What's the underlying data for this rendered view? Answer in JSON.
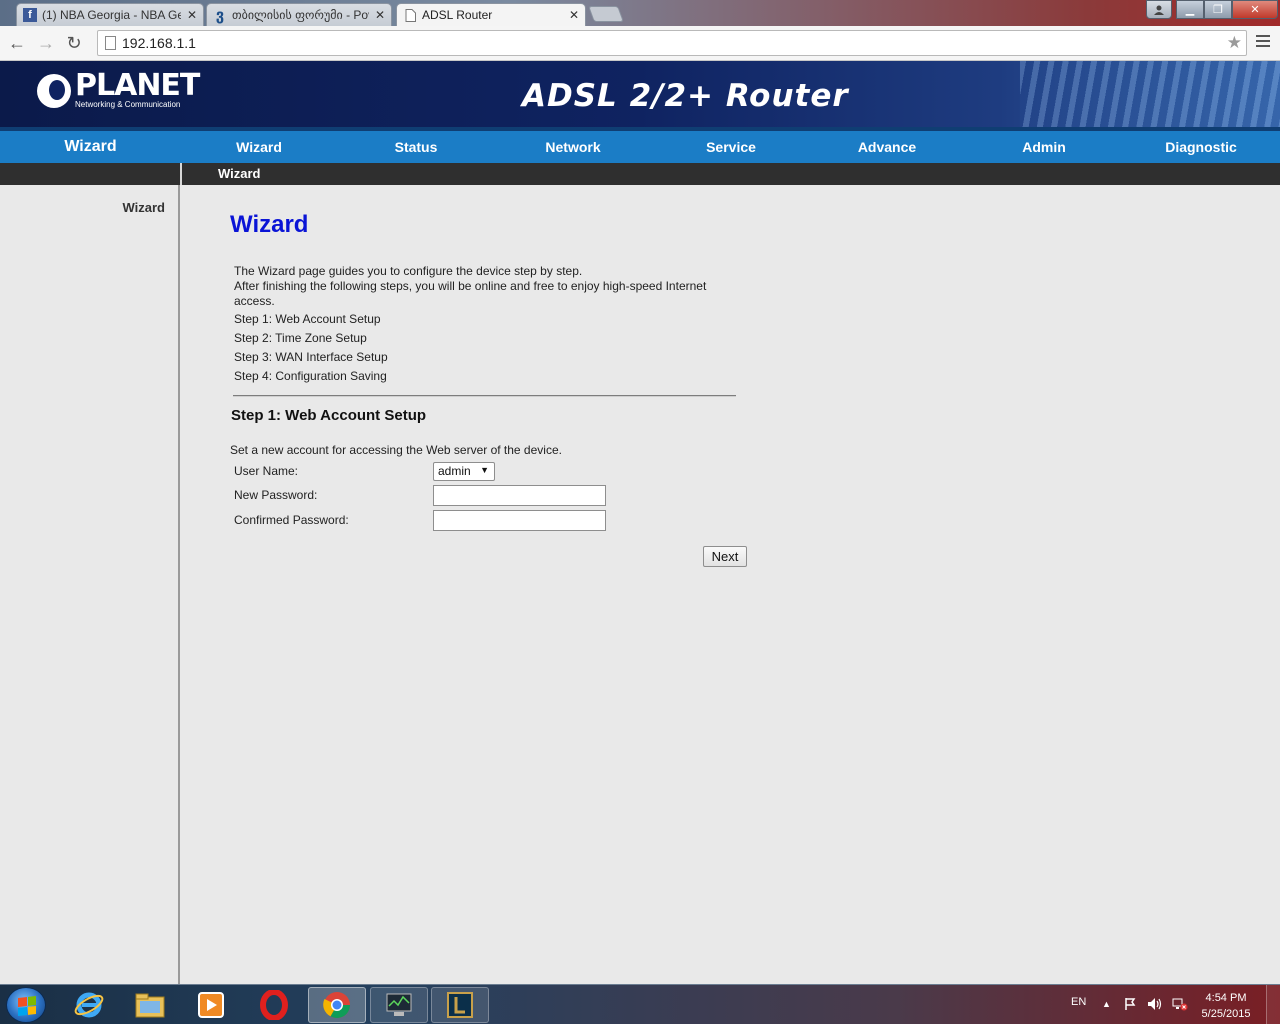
{
  "browser": {
    "tabs": [
      {
        "title": "(1) NBA Georgia - NBA Ge",
        "icon": "facebook-icon",
        "active": false
      },
      {
        "title": "თბილისის ფორუმი - Pov",
        "icon": "forum-icon",
        "active": false
      },
      {
        "title": "ADSL Router",
        "icon": "page-icon",
        "active": true
      }
    ],
    "url": "192.168.1.1"
  },
  "header": {
    "brand": "PLANET",
    "tagline": "Networking & Communication",
    "product": "ADSL 2/2+ Router"
  },
  "nav": {
    "current": "Wizard",
    "items": [
      "Wizard",
      "Status",
      "Network",
      "Service",
      "Advance",
      "Admin",
      "Diagnostic"
    ]
  },
  "subnav": {
    "item": "Wizard"
  },
  "sidebar": {
    "item": "Wizard"
  },
  "main": {
    "title": "Wizard",
    "intro_line1": "The Wizard page guides you to configure the device step by step.",
    "intro_line2": "After finishing the following steps, you will be online and free to enjoy high-speed Internet access.",
    "steps": [
      "Step 1: Web Account Setup",
      "Step 2: Time Zone Setup",
      "Step 3: WAN Interface Setup",
      "Step 4: Configuration Saving"
    ],
    "section_title": "Step 1: Web Account Setup",
    "section_desc": "Set a new account for accessing the Web server of the device.",
    "user_name_label": "User Name:",
    "user_name_value": "admin",
    "new_password_label": "New Password:",
    "confirmed_password_label": "Confirmed Password:",
    "next_label": "Next"
  },
  "taskbar": {
    "language": "EN",
    "time": "4:54 PM",
    "date": "5/25/2015"
  }
}
